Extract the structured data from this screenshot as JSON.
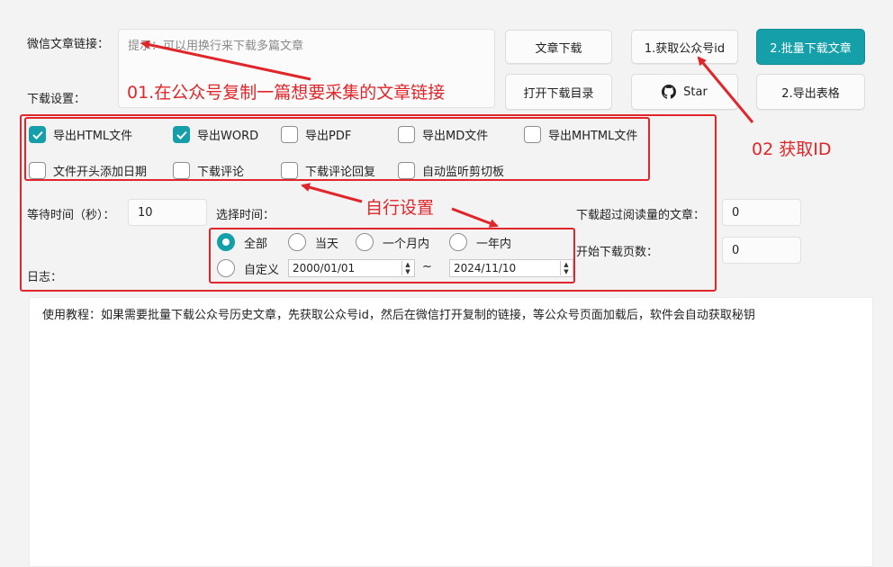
{
  "labels": {
    "article_link": "微信文章链接：",
    "download_settings": "下载设置：",
    "wait_time": "等待时间（秒）：",
    "select_time": "选择时间：",
    "log": "日志：",
    "read_count": "下载超过阅读量的文章：",
    "start_page": "开始下载页数："
  },
  "link_input": {
    "placeholder": "提示：可以用换行来下载多篇文章"
  },
  "buttons": {
    "article_download": "文章下载",
    "get_account_id": "1.获取公众号id",
    "batch_download": "2.批量下载文章",
    "open_dir": "打开下载目录",
    "star": "Star",
    "export_table": "2.导出表格"
  },
  "checkboxes": [
    {
      "label": "导出HTML文件",
      "checked": true
    },
    {
      "label": "导出WORD",
      "checked": true
    },
    {
      "label": "导出PDF",
      "checked": false
    },
    {
      "label": "导出MD文件",
      "checked": false
    },
    {
      "label": "导出MHTML文件",
      "checked": false
    },
    {
      "label": "文件开头添加日期",
      "checked": false
    },
    {
      "label": "下载评论",
      "checked": false
    },
    {
      "label": "下载评论回复",
      "checked": false
    },
    {
      "label": "自动监听剪切板",
      "checked": false
    }
  ],
  "wait_time_value": "10",
  "time_options": [
    {
      "label": "全部",
      "selected": true
    },
    {
      "label": "当天",
      "selected": false
    },
    {
      "label": "一个月内",
      "selected": false
    },
    {
      "label": "一年内",
      "selected": false
    },
    {
      "label": "自定义",
      "selected": false
    }
  ],
  "date_range": {
    "start": "2000/01/01",
    "separator": "~",
    "end": "2024/11/10"
  },
  "read_count_value": "0",
  "start_page_value": "0",
  "log_text": "使用教程：如果需要批量下载公众号历史文章，先获取公众号id，然后在微信打开复制的链接，等公众号页面加载后，软件会自动获取秘钥",
  "annotations": {
    "step1": "01.在公众号复制一篇想要采集的文章链接",
    "step2": "02 获取ID",
    "custom": "自行设置"
  },
  "colors": {
    "accent": "#159fa8",
    "annotation_red": "#e0262a"
  },
  "icons": {
    "star_button": "github-icon"
  }
}
